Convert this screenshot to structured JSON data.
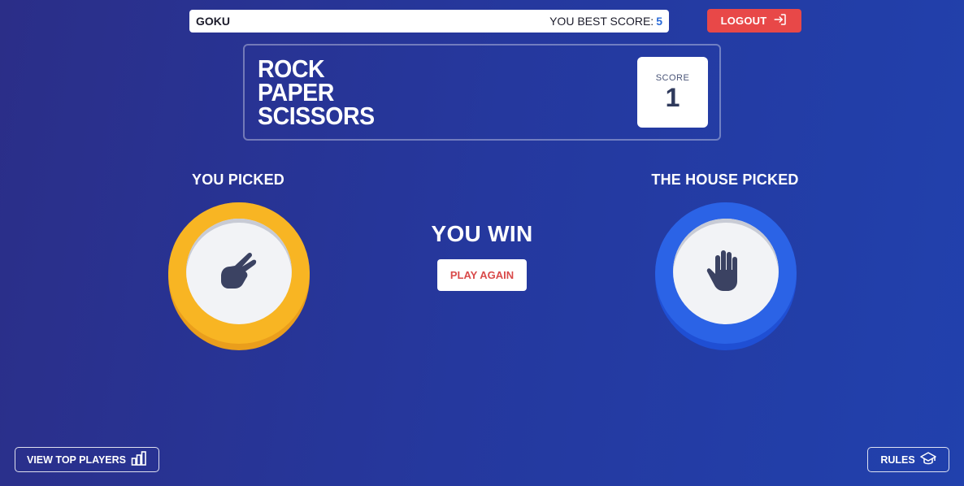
{
  "topbar": {
    "username": "GOKU",
    "best_score_label": "YOU BEST SCORE:",
    "best_score_value": "5"
  },
  "logout": {
    "label": "LOGOUT",
    "icon": "logout-icon"
  },
  "header": {
    "title_lines": [
      "ROCK",
      "PAPER",
      "SCISSORS"
    ],
    "score_label": "SCORE",
    "score_value": "1"
  },
  "game": {
    "you_picked_label": "YOU PICKED",
    "house_picked_label": "THE HOUSE PICKED",
    "you_choice": "scissors",
    "house_choice": "paper",
    "result": "YOU WIN",
    "play_again_label": "PLAY AGAIN"
  },
  "footer": {
    "view_top_players_label": "VIEW TOP PLAYERS",
    "rules_label": "RULES"
  },
  "colors": {
    "background_start": "#2b2e88",
    "background_end": "#2141ad",
    "scissors_coin": "#f8b523",
    "paper_coin": "#2b63e6",
    "logout_button": "#e84848",
    "play_again_text": "#d94a4a",
    "best_score_value": "#2a6bd8"
  }
}
